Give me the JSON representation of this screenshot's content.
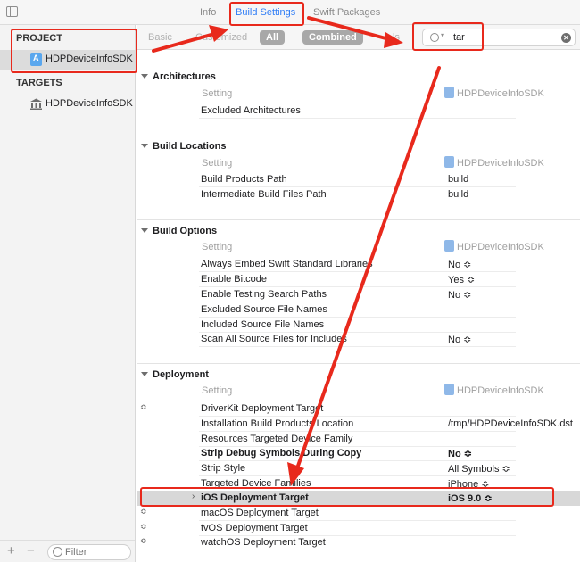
{
  "tabs": [
    {
      "label": "Info"
    },
    {
      "label": "Build Settings"
    },
    {
      "label": "Swift Packages"
    }
  ],
  "sidebar": {
    "project_header": "PROJECT",
    "project_item": "HDPDeviceInfoSDK",
    "targets_header": "TARGETS",
    "target_item": "HDPDeviceInfoSDK",
    "filter_placeholder": "Filter"
  },
  "filterbar": {
    "basic": "Basic",
    "customized": "Customized",
    "all": "All",
    "combined": "Combined",
    "levels": "ls",
    "search_value": "tar"
  },
  "column_header": {
    "setting": "Setting",
    "project": "HDPDeviceInfoSDK"
  },
  "sections": [
    {
      "title": "Architectures",
      "rows": [
        {
          "name": "Excluded Architectures",
          "value": ""
        }
      ]
    },
    {
      "title": "Build Locations",
      "rows": [
        {
          "name": "Build Products Path",
          "value": "build"
        },
        {
          "name": "Intermediate Build Files Path",
          "value": "build"
        }
      ]
    },
    {
      "title": "Build Options",
      "rows": [
        {
          "name": "Always Embed Swift Standard Libraries",
          "value": "No ≎"
        },
        {
          "name": "Enable Bitcode",
          "value": "Yes ≎"
        },
        {
          "name": "Enable Testing Search Paths",
          "value": "No ≎"
        },
        {
          "name": "Excluded Source File Names",
          "value": ""
        },
        {
          "name": "Included Source File Names",
          "value": ""
        },
        {
          "name": "Scan All Source Files for Includes",
          "value": "No ≎"
        }
      ]
    },
    {
      "title": "Deployment",
      "rows": [
        {
          "name": "DriverKit Deployment Target",
          "value": "",
          "stepper": "≎"
        },
        {
          "name": "Installation Build Products Location",
          "value": "/tmp/HDPDeviceInfoSDK.dst"
        },
        {
          "name": "Resources Targeted Device Family",
          "value": ""
        },
        {
          "name": "Strip Debug Symbols During Copy",
          "value": "No ≎",
          "bold": true
        },
        {
          "name": "Strip Style",
          "value": "All Symbols ≎"
        },
        {
          "name": "Targeted Device Families",
          "value": "iPhone ≎"
        },
        {
          "name": "iOS Deployment Target",
          "value": "iOS 9.0 ≎",
          "bold": true,
          "selected": true
        },
        {
          "name": "macOS Deployment Target",
          "value": "",
          "stepper": "≎"
        },
        {
          "name": "tvOS Deployment Target",
          "value": "",
          "stepper": "≎"
        },
        {
          "name": "watchOS Deployment Target",
          "value": "",
          "stepper": "≎"
        }
      ]
    }
  ],
  "colors": {
    "accent": "#2f7df6",
    "annotation_red": "#e8291c",
    "selection": "#d8d8d8"
  },
  "icons": {
    "sidebar_toggle": "sidebar-toggle-icon",
    "project": "xcode-project-icon",
    "target": "framework-target-icon",
    "search": "search-icon",
    "clear": "clear-icon",
    "add": "plus-icon",
    "remove": "minus-icon"
  }
}
